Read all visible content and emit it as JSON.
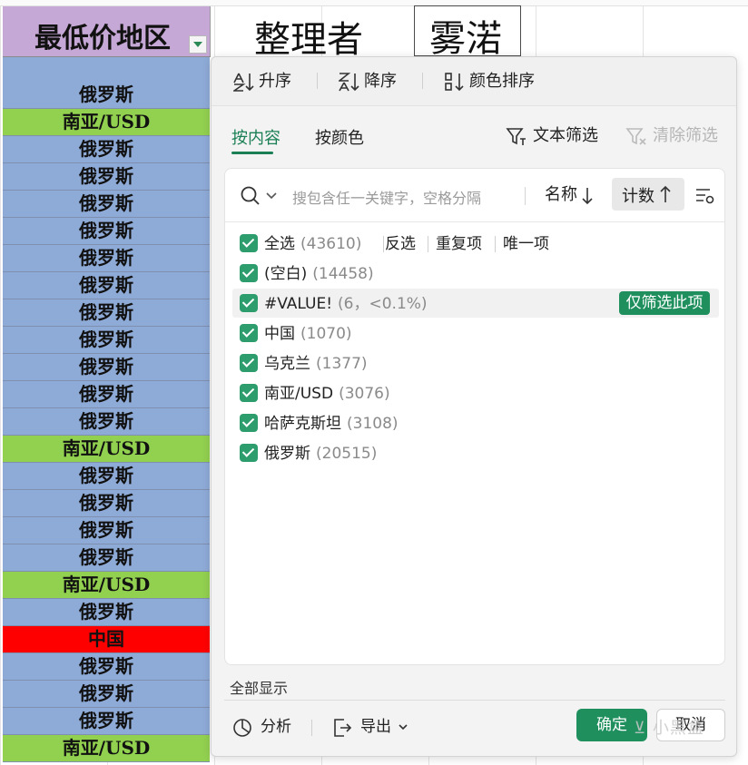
{
  "sheet": {
    "header": {
      "col_a": "最低价地区",
      "col_b": "整理者",
      "col_c": "雾渃"
    },
    "rows": [
      {
        "text": "俄罗斯",
        "color": "blue"
      },
      {
        "text": "南亚/USD",
        "color": "green"
      },
      {
        "text": "俄罗斯",
        "color": "blue"
      },
      {
        "text": "俄罗斯",
        "color": "blue"
      },
      {
        "text": "俄罗斯",
        "color": "blue"
      },
      {
        "text": "俄罗斯",
        "color": "blue"
      },
      {
        "text": "俄罗斯",
        "color": "blue"
      },
      {
        "text": "俄罗斯",
        "color": "blue"
      },
      {
        "text": "俄罗斯",
        "color": "blue"
      },
      {
        "text": "俄罗斯",
        "color": "blue"
      },
      {
        "text": "俄罗斯",
        "color": "blue"
      },
      {
        "text": "俄罗斯",
        "color": "blue"
      },
      {
        "text": "俄罗斯",
        "color": "blue"
      },
      {
        "text": "南亚/USD",
        "color": "green"
      },
      {
        "text": "俄罗斯",
        "color": "blue"
      },
      {
        "text": "俄罗斯",
        "color": "blue"
      },
      {
        "text": "俄罗斯",
        "color": "blue"
      },
      {
        "text": "俄罗斯",
        "color": "blue"
      },
      {
        "text": "南亚/USD",
        "color": "green"
      },
      {
        "text": "俄罗斯",
        "color": "blue"
      },
      {
        "text": "中国",
        "color": "red"
      },
      {
        "text": "俄罗斯",
        "color": "blue"
      },
      {
        "text": "俄罗斯",
        "color": "blue"
      },
      {
        "text": "俄罗斯",
        "color": "blue"
      },
      {
        "text": "南亚/USD",
        "color": "green"
      }
    ],
    "colors": {
      "blue": "#8eaad6",
      "green": "#92d050",
      "red": "#ff0000",
      "header_purple": "#c6a8d6"
    }
  },
  "popup": {
    "sort": {
      "asc": "升序",
      "desc": "降序",
      "color": "颜色排序"
    },
    "tabs": {
      "by_content": "按内容",
      "by_color": "按颜色"
    },
    "text_filter": "文本筛选",
    "clear_filter": "清除筛选",
    "search": {
      "placeholder": "搜包含任一关键字，空格分隔",
      "sort_name": "名称",
      "sort_count": "计数"
    },
    "select_all": {
      "label": "全选",
      "count": "(43610)"
    },
    "links": {
      "invert": "反选",
      "duplicates": "重复项",
      "unique": "唯一项"
    },
    "items": [
      {
        "label": "(空白)",
        "count": "(14458)"
      },
      {
        "label": "#VALUE!",
        "count": "(6，<0.1%)"
      },
      {
        "label": "中国",
        "count": "(1070)"
      },
      {
        "label": "乌克兰",
        "count": "(1377)"
      },
      {
        "label": "南亚/USD",
        "count": "(3076)"
      },
      {
        "label": "哈萨克斯坦",
        "count": "(3108)"
      },
      {
        "label": "俄罗斯",
        "count": "(20515)"
      }
    ],
    "only_this": "仅筛选此项",
    "show_all": "全部显示",
    "analyze": "分析",
    "export": "导出",
    "ok": "确定",
    "cancel": "取消",
    "accent": "#1f8f5e"
  },
  "watermark": "小黑盒"
}
